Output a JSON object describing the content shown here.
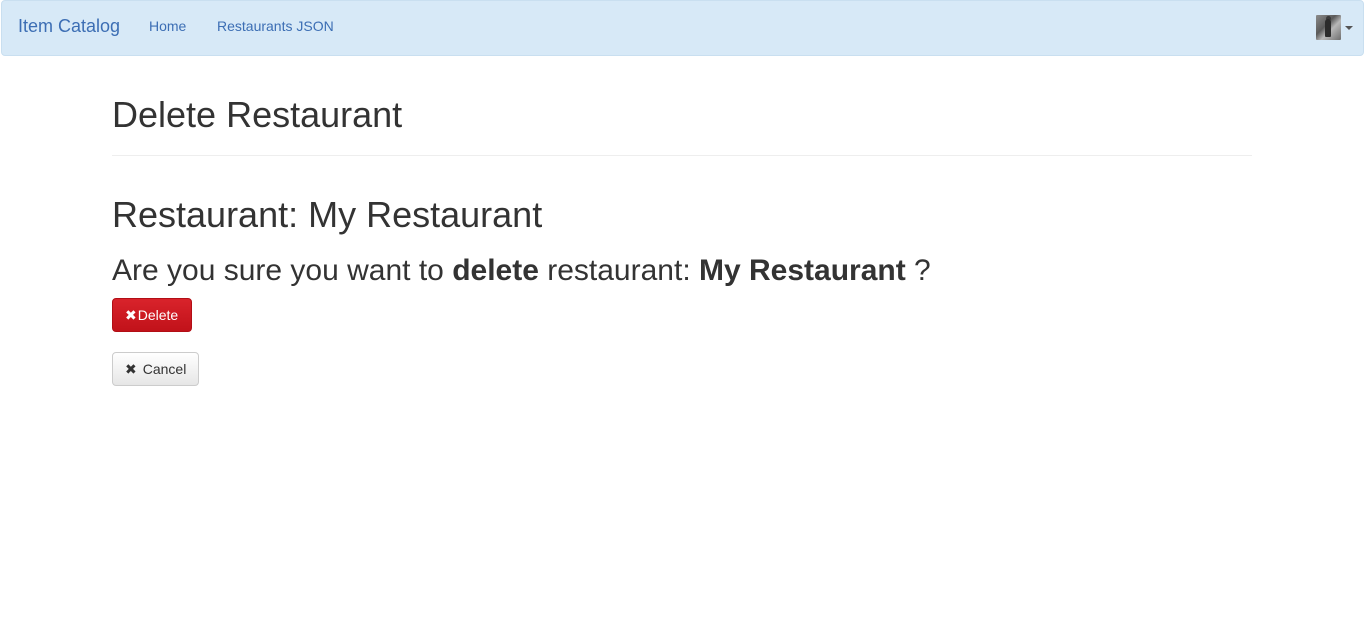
{
  "navbar": {
    "brand": "Item Catalog",
    "links": [
      {
        "label": "Home"
      },
      {
        "label": "Restaurants JSON"
      }
    ]
  },
  "page": {
    "title": "Delete Restaurant",
    "restaurant_heading": "Restaurant: My Restaurant",
    "confirm": {
      "prefix": "Are you sure you want to ",
      "action": "delete",
      "middle": " restaurant: ",
      "name": "My Restaurant",
      "suffix": " ?"
    }
  },
  "buttons": {
    "delete_label": "Delete",
    "cancel_label": "Cancel",
    "delete_icon": "times-icon",
    "cancel_icon": "times-icon"
  },
  "colors": {
    "navbar_bg": "#d7e9f7",
    "link": "#3c6eb4",
    "danger": "#c9151e"
  }
}
